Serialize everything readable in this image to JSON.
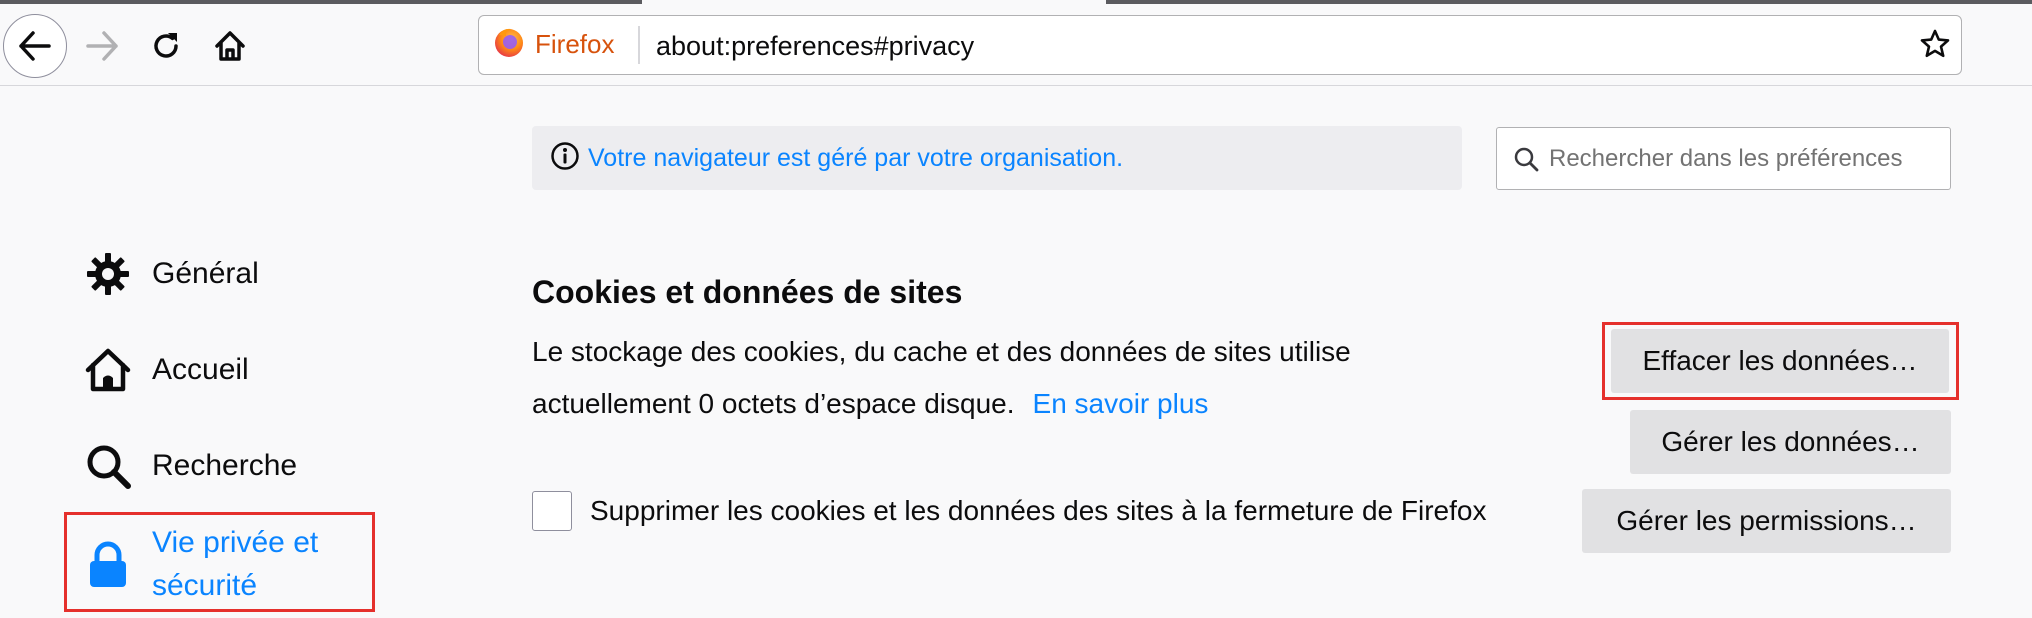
{
  "browser": {
    "identity_label": "Firefox",
    "url": "about:preferences#privacy"
  },
  "sidebar": {
    "items": [
      {
        "label": "Général",
        "icon": "gear-icon"
      },
      {
        "label": "Accueil",
        "icon": "home-icon"
      },
      {
        "label": "Recherche",
        "icon": "search-icon"
      },
      {
        "label_line1": "Vie privée et",
        "label_line2": "sécurité",
        "icon": "lock-icon",
        "selected": true
      }
    ]
  },
  "main": {
    "policy_notice": "Votre navigateur est géré par votre organisation.",
    "search_placeholder": "Rechercher dans les préférences",
    "section_title": "Cookies et données de sites",
    "description_line1": "Le stockage des cookies, du cache et des données de sites utilise",
    "description_line2": "actuellement 0 octets d’espace disque.",
    "learn_more": "En savoir plus",
    "clear_data_button": "Effacer les données…",
    "manage_data_button": "Gérer les données…",
    "manage_permissions_button": "Gérer les permissions…",
    "delete_on_close_label": "Supprimer les cookies et les données des sites à la fermeture de Firefox",
    "delete_on_close_checked": false
  },
  "colors": {
    "accent": "#0a84ff",
    "highlight": "#e5302c",
    "firefox_label": "#d7520c"
  }
}
